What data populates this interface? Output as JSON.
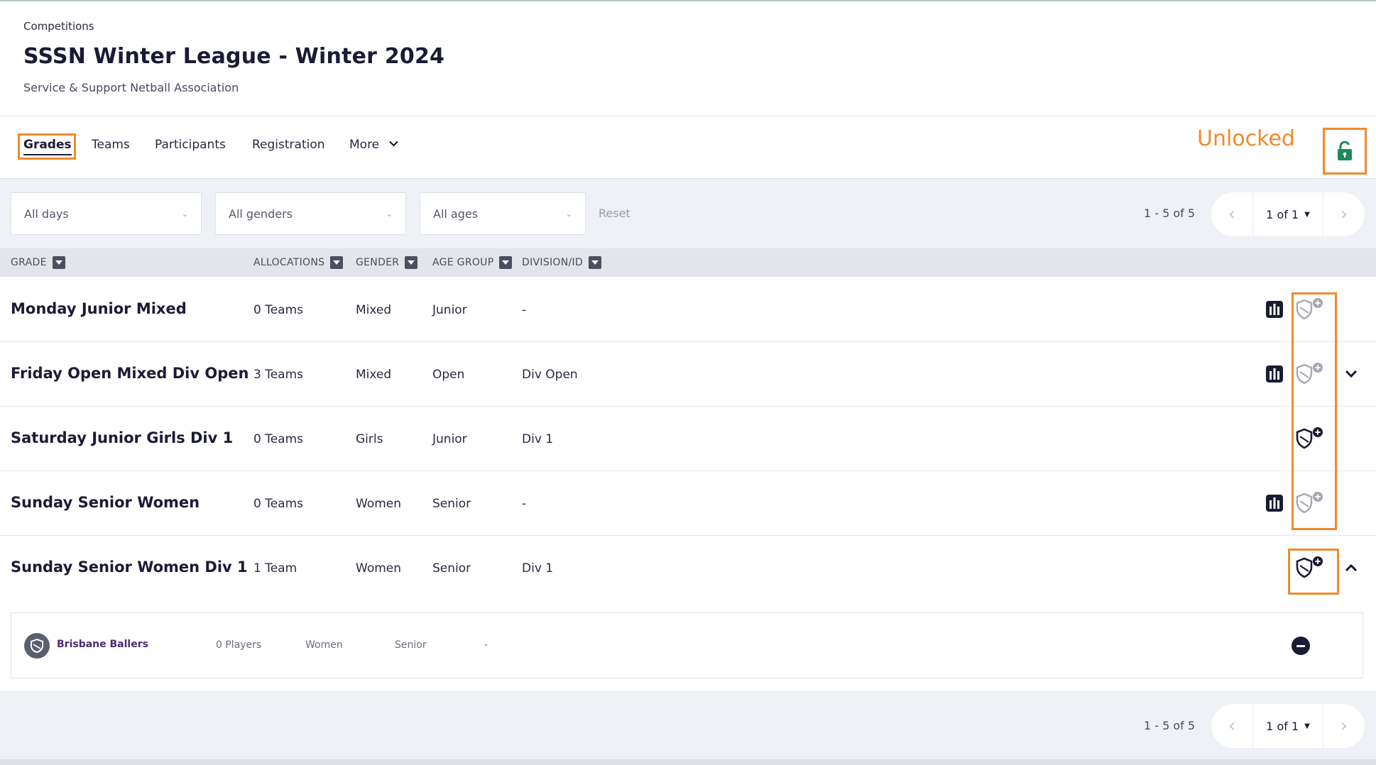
{
  "header": {
    "breadcrumb": "Competitions",
    "title": "SSSN Winter League - Winter 2024",
    "organisation": "Service & Support Netball Association"
  },
  "tabs": [
    {
      "label": "Grades",
      "active": true
    },
    {
      "label": "Teams"
    },
    {
      "label": "Participants"
    },
    {
      "label": "Registration"
    },
    {
      "label": "More"
    }
  ],
  "lock": {
    "status_label": "Unlocked",
    "icon": "unlocked-padlock-icon",
    "color": "#1f8a5a"
  },
  "annotation_color": "#f08a2c",
  "filters": {
    "days": "All days",
    "genders": "All genders",
    "ages": "All ages",
    "reset": "Reset"
  },
  "pagination": {
    "count": "1 - 5 of 5",
    "page": "1 of 1"
  },
  "columns": {
    "grade": "GRADE",
    "allocations": "ALLOCATIONS",
    "gender": "GENDER",
    "age_group": "AGE GROUP",
    "division": "DIVISION/ID"
  },
  "rows": [
    {
      "grade": "Monday Junior Mixed",
      "allocations": "0 Teams",
      "gender": "Mixed",
      "age": "Junior",
      "division": "-",
      "ladder": true,
      "shield": "grey",
      "chevron": "none"
    },
    {
      "grade": "Friday Open Mixed Div Open",
      "allocations": "3 Teams",
      "gender": "Mixed",
      "age": "Open",
      "division": "Div Open",
      "ladder": true,
      "shield": "grey",
      "chevron": "down"
    },
    {
      "grade": "Saturday Junior Girls Div 1",
      "allocations": "0 Teams",
      "gender": "Girls",
      "age": "Junior",
      "division": "Div 1",
      "ladder": false,
      "shield": "dark",
      "chevron": "none"
    },
    {
      "grade": "Sunday Senior Women",
      "allocations": "0 Teams",
      "gender": "Women",
      "age": "Senior",
      "division": "-",
      "ladder": true,
      "shield": "grey",
      "chevron": "none"
    },
    {
      "grade": "Sunday Senior Women Div 1",
      "allocations": "1 Team",
      "gender": "Women",
      "age": "Senior",
      "division": "Div 1",
      "ladder": false,
      "shield": "dark",
      "chevron": "up"
    }
  ],
  "expanded_team": {
    "name": "Brisbane Ballers",
    "players": "0 Players",
    "gender": "Women",
    "age": "Senior",
    "division": "-"
  }
}
